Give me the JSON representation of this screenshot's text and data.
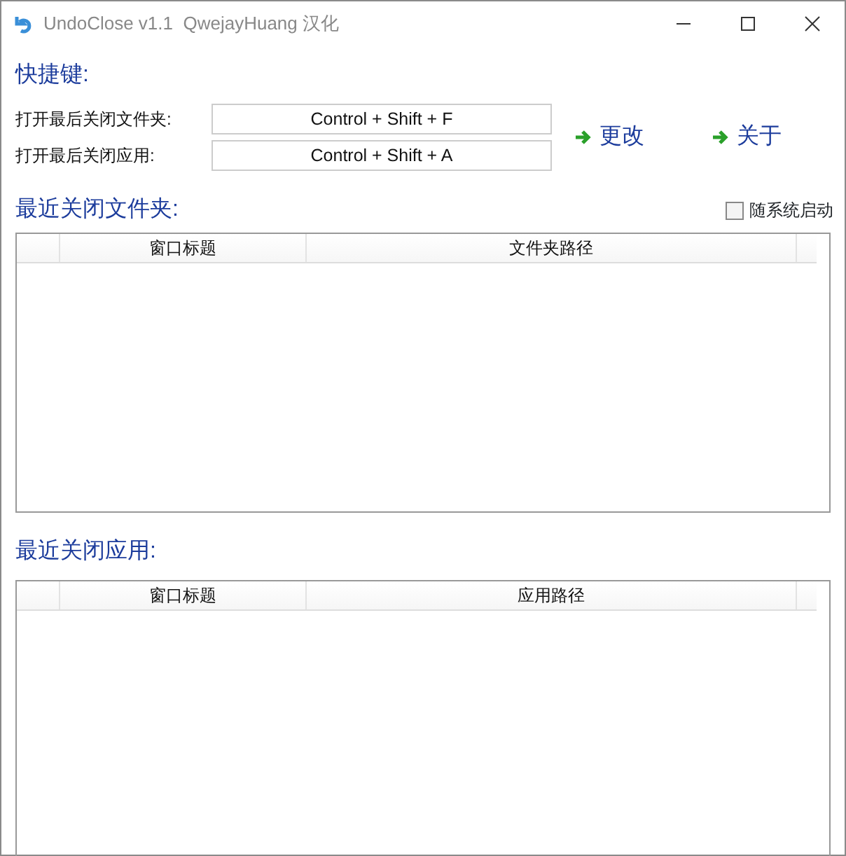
{
  "window": {
    "title": "UndoClose v1.1  QwejayHuang 汉化"
  },
  "hotkeys": {
    "title": "快捷键:",
    "rows": [
      {
        "label": "打开最后关闭文件夹:",
        "value": "Control + Shift + F"
      },
      {
        "label": "打开最后关闭应用:",
        "value": "Control + Shift + A"
      }
    ],
    "buttons": [
      "更改",
      "关于"
    ]
  },
  "autostart": {
    "label": "随系统启动",
    "checked": false
  },
  "sections": [
    {
      "title": "最近关闭文件夹:",
      "columns": [
        "窗口标题",
        "文件夹路径"
      ]
    },
    {
      "title": "最近关闭应用:",
      "columns": [
        "窗口标题",
        "应用路径"
      ]
    }
  ]
}
